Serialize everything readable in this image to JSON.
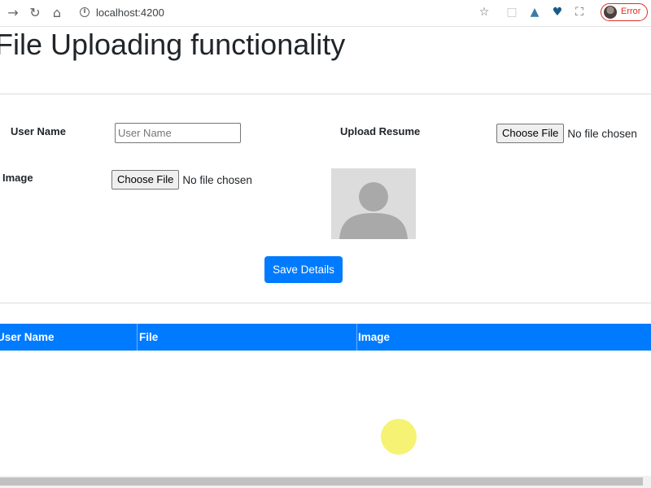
{
  "browser": {
    "url": "localhost:4200",
    "profile_status": "Error"
  },
  "page": {
    "title": "File Uploading functionality"
  },
  "form": {
    "username_label": "User Name",
    "username_placeholder": "User Name",
    "username_value": "",
    "resume_label": "Upload Resume",
    "resume_button": "Choose File",
    "resume_status": "No file chosen",
    "image_label": "Image",
    "image_button": "Choose File",
    "image_status": "No file chosen",
    "image_preview_icon": "user-silhouette",
    "save_label": "Save Details"
  },
  "table": {
    "columns": [
      "User Name",
      "File",
      "Image"
    ],
    "rows": []
  },
  "colors": {
    "primary": "#007bff",
    "placeholder_bg": "#dcdcdc",
    "error": "#d93025"
  }
}
